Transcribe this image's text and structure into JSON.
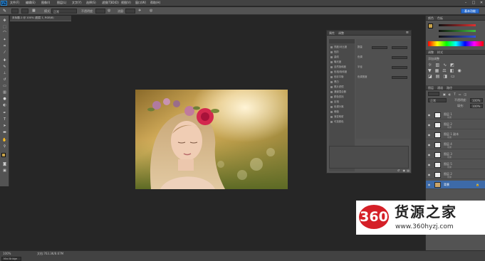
{
  "app": {
    "logo": "Ps",
    "menu": [
      "文件(F)",
      "编辑(E)",
      "图像(I)",
      "图层(L)",
      "文字(Y)",
      "选择(S)",
      "滤镜(T)",
      "3D(D)",
      "视图(V)",
      "窗口(W)",
      "帮助(H)"
    ],
    "workspace_button": "基本功能"
  },
  "options_bar": {
    "mode_label": "模式:",
    "mode_value": "正常",
    "opacity_label": "不透明度:",
    "flow_label": "流量:"
  },
  "document": {
    "tab_title": "未标题-1 @ 100% (图层 1, RGB/8)",
    "zoom": "100%",
    "doc_info": "文档:763.3K/8.67M"
  },
  "adjustments_panel": {
    "tabs": [
      "属性",
      "调整"
    ],
    "items": [
      "亮度/对比度",
      "色阶",
      "曲线",
      "曝光度",
      "自然饱和度",
      "色相/饱和度",
      "色彩平衡",
      "黑白",
      "照片滤镜",
      "通道混合器",
      "颜色查找",
      "反相",
      "色调分离",
      "阈值",
      "渐变映射",
      "可选颜色"
    ],
    "right_labels": [
      "数量",
      "色调",
      "半径",
      "色调宽度"
    ]
  },
  "dock": {
    "color_tabs": [
      "颜色",
      "色板"
    ],
    "adjust_tabs": [
      "调整",
      "样式"
    ],
    "add_adjustment": "添加调整",
    "layers_tabs": [
      "图层",
      "通道",
      "路径"
    ],
    "blend_mode": "正常",
    "opacity_label": "不透明度:",
    "opacity_value": "100%",
    "fill_label": "填充:",
    "fill_value": "100%",
    "layers": [
      {
        "name": "图层 1",
        "sub": "效果"
      },
      {
        "name": "图层 2",
        "sub": "效果"
      },
      {
        "name": "图层 1 副本",
        "sub": "效果"
      },
      {
        "name": "图层 4",
        "sub": "效果"
      },
      {
        "name": "图层 3",
        "sub": "效果"
      },
      {
        "name": "图层 5",
        "sub": "效果"
      },
      {
        "name": "图层 2",
        "sub": "效果"
      },
      {
        "name": "背景",
        "sub": ""
      }
    ]
  },
  "statusbar": {
    "tab": "Mini Bridge"
  },
  "watermark": {
    "badge": "360",
    "brand": "货源之家",
    "url": "www.360hyzj.com"
  },
  "colors": {
    "accent": "#2b6fd2",
    "brand_red": "#d51f27"
  }
}
